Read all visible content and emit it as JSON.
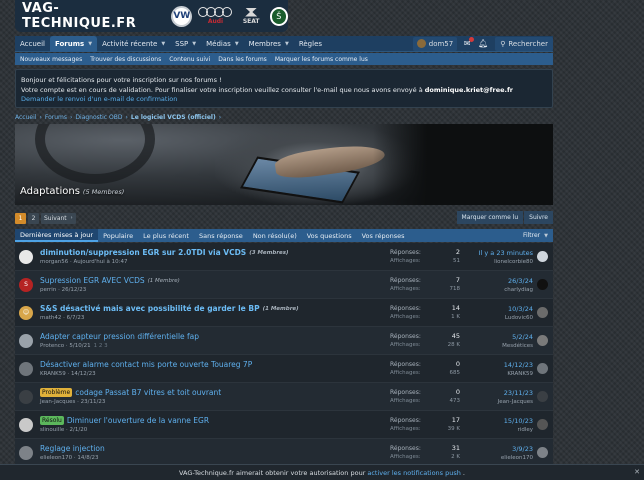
{
  "site": {
    "name": "VAG-TECHNIQUE.FR",
    "brands": [
      "VW",
      "Audi",
      "SEAT",
      "Škoda"
    ],
    "audi_word": "Audi",
    "seat_word": "SEAT",
    "vw_mark": "VW",
    "skoda_mark": "Š"
  },
  "nav": {
    "items": [
      {
        "label": "Accueil",
        "active": false,
        "caret": false
      },
      {
        "label": "Forums",
        "active": true,
        "caret": true
      },
      {
        "label": "Activité récente",
        "active": false,
        "caret": true
      },
      {
        "label": "SSP",
        "active": false,
        "caret": true
      },
      {
        "label": "Médias",
        "active": false,
        "caret": true
      },
      {
        "label": "Membres",
        "active": false,
        "caret": true
      },
      {
        "label": "Règles",
        "active": false,
        "caret": false
      }
    ],
    "username": "dom57",
    "search_label": "Rechercher"
  },
  "subnav": [
    "Nouveaux messages",
    "Trouver des discussions",
    "Contenu suivi",
    "Dans les forums",
    "Marquer les forums comme lus"
  ],
  "notice": {
    "line1": "Bonjour et félicitations pour votre inscription sur nos forums !",
    "line2_pre": "Votre compte est en cours de validation. Pour finaliser votre inscription veuillez consulter l'e-mail que nous avons envoyé à ",
    "email": "dominique.kriet@free.fr",
    "resend": "Demander le renvoi d'un e-mail de confirmation"
  },
  "breadcrumb": [
    "Accueil",
    "Forums",
    "Diagnostic OBD",
    "Le logiciel VCDS (officiel)"
  ],
  "banner": {
    "title": "Adaptations",
    "members": "(5 Membres)"
  },
  "pager": {
    "pages": [
      "1",
      "2"
    ],
    "current": "1",
    "next": "Suivant"
  },
  "actions": {
    "mark_read": "Marquer comme lu",
    "follow": "Suivre"
  },
  "filters": {
    "tabs": [
      "Dernières mises à jour",
      "Populaire",
      "Le plus récent",
      "Sans réponse",
      "Non résolu(e)",
      "Vos questions",
      "Vos réponses"
    ],
    "active": 0,
    "filter_label": "Filtrer"
  },
  "labels": {
    "replies": "Réponses:",
    "views": "Affichages:"
  },
  "threads": [
    {
      "title": "diminution/suppression EGR sur 2.0TDI via VCDS",
      "bold": true,
      "members": "(3 Membres)",
      "members_bold": true,
      "author": "morgan56",
      "date": "Aujourd'hui à 10:47",
      "pages": "",
      "prefix": "",
      "replies": "2",
      "views": "51",
      "last_date": "Il y a 23 minutes",
      "last_user": "lionelcorbie80",
      "avatar_color": "#e8e8e8",
      "avatar_text": "",
      "last_avatar_color": "#cfd6dd"
    },
    {
      "title": "Supression EGR AVEC VCDS",
      "bold": false,
      "members": "(1 Membre)",
      "members_bold": false,
      "author": "perrin",
      "date": "26/12/23",
      "pages": "",
      "prefix": "",
      "replies": "7",
      "views": "718",
      "last_date": "26/3/24",
      "last_user": "charlydiag",
      "avatar_color": "#b52323",
      "avatar_text": "S",
      "last_avatar_color": "#111"
    },
    {
      "title": "S&S désactivé mais avec possibilité de garder le BP",
      "bold": true,
      "members": "(1 Membre)",
      "members_bold": true,
      "author": "math42",
      "date": "6/7/23",
      "pages": "",
      "prefix": "",
      "replies": "14",
      "views": "1 K",
      "last_date": "10/3/24",
      "last_user": "Ludovic60",
      "avatar_color": "#d8a64a",
      "avatar_text": "☺",
      "last_avatar_color": "#6b6b6b"
    },
    {
      "title": "Adapter capteur pression différentielle fap",
      "bold": false,
      "members": "",
      "members_bold": false,
      "author": "Protenco",
      "date": "5/10/21",
      "pages": "1  2  3",
      "prefix": "",
      "replies": "45",
      "views": "28 K",
      "last_date": "5/2/24",
      "last_user": "Mesdétices",
      "avatar_color": "#9aa2aa",
      "avatar_text": "",
      "last_avatar_color": "#7a7a7a"
    },
    {
      "title": "Désactiver alarme contact mis porte ouverte Touareg 7P",
      "bold": false,
      "members": "",
      "members_bold": false,
      "author": "KRANK59",
      "date": "14/12/23",
      "pages": "",
      "prefix": "",
      "replies": "0",
      "views": "685",
      "last_date": "14/12/23",
      "last_user": "KRANK59",
      "avatar_color": "#6f757b",
      "avatar_text": "",
      "last_avatar_color": "#6f757b"
    },
    {
      "title": "codage Passat B7 vitres et toit ouvrant",
      "bold": false,
      "members": "",
      "members_bold": false,
      "author": "Jean-Jacques",
      "date": "23/11/23",
      "pages": "",
      "prefix": "Problème",
      "prefix_color": "#e0b13a",
      "replies": "0",
      "views": "473",
      "last_date": "23/11/23",
      "last_user": "Jean-Jacques",
      "avatar_color": "#3a3f44",
      "avatar_text": "",
      "last_avatar_color": "#3a3f44"
    },
    {
      "title": "Diminuer l'ouverture de la vanne EGR",
      "bold": false,
      "members": "",
      "members_bold": false,
      "author": "slinouille",
      "date": "2/1/20",
      "pages": "",
      "prefix": "Résolu",
      "prefix_color": "#5cb85c",
      "replies": "17",
      "views": "39 K",
      "last_date": "15/10/23",
      "last_user": "ridley",
      "avatar_color": "#c9c9c9",
      "avatar_text": "",
      "last_avatar_color": "#555"
    },
    {
      "title": "Reglage injection",
      "bold": false,
      "members": "",
      "members_bold": false,
      "author": "elieleon170",
      "date": "14/8/23",
      "pages": "",
      "prefix": "",
      "replies": "31",
      "views": "2 K",
      "last_date": "3/9/23",
      "last_user": "elieleon170",
      "avatar_color": "#7d8288",
      "avatar_text": "",
      "last_avatar_color": "#7d8288"
    }
  ],
  "push": {
    "pre": "VAG-Technique.fr aimerait obtenir votre autorisation pour",
    "link": "activer les notifications push",
    "post": "."
  },
  "colors": {
    "nav": "#1e3f61",
    "accent": "#2c5d8d",
    "link": "#5fb0ee",
    "pager_current": "#d38b2a"
  }
}
